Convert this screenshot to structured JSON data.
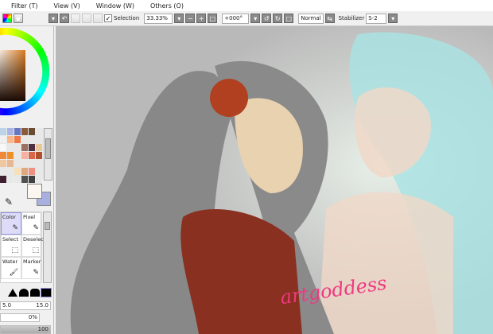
{
  "menu": {
    "items": [
      "Filter (T)",
      "View (V)",
      "Window (W)",
      "Others (O)"
    ]
  },
  "toolbar": {
    "selection_label": "Selection",
    "selection_checked": true,
    "zoom": "33.33%",
    "rotation": "+000°",
    "blend_mode": "Normal",
    "stabilizer_label": "Stabilizer",
    "stabilizer": "S-2"
  },
  "colors": {
    "primary": "#fbf6f0",
    "secondary": "#a8b0e0",
    "accent": "#9090e0"
  },
  "swatches": [
    "#bcd4e8",
    "#aab4e4",
    "#6878c0",
    "#8a5a3a",
    "#6a4a30",
    "#e8e8e8",
    "#f0f0f0",
    "#f8b888",
    "#f07848",
    "#e8e8e8",
    "#e8e8e8",
    "#e8e8e8",
    "#f8f8f8",
    "#e8e8e8",
    "#e8e8e8",
    "#9a7060",
    "#503040",
    "#e8c898",
    "#f08838",
    "#f09028",
    "#e8e8e8",
    "#f8b0a0",
    "#d86848",
    "#b05030",
    "#f0c8a0",
    "#e8b890",
    "#e8e8e8",
    "#e8e8e8",
    "#e8e8e8",
    "#e8e8e8",
    "#e8e8e8",
    "#e8e8e8",
    "#f8e0b8",
    "#e0a880",
    "#f09080",
    "#e8e8e8",
    "#402030",
    "#e8e8e8",
    "#e8e8e8",
    "#505050",
    "#404040",
    "#e8e8e8"
  ],
  "tools": [
    {
      "label": "Color",
      "icon": "pencil-icon",
      "selected": true
    },
    {
      "label": "Pixel",
      "icon": "pencil-icon"
    },
    {
      "label": "Select",
      "icon": "select-brush-icon"
    },
    {
      "label": "Deselect",
      "icon": "deselect-brush-icon"
    },
    {
      "label": "Water",
      "icon": "water-brush-icon"
    },
    {
      "label": "Marker",
      "icon": "marker-icon"
    }
  ],
  "brush": {
    "size_min": "5.0",
    "size": "15.0",
    "min_size": "0%",
    "density": "100"
  },
  "canvas": {
    "watermark": "artgoddess"
  }
}
